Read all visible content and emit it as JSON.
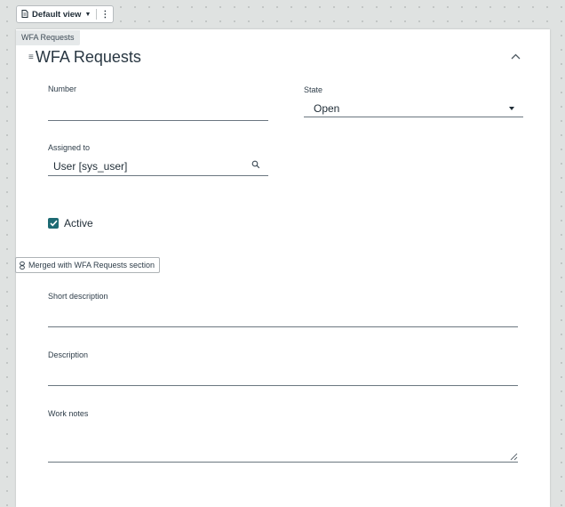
{
  "toolbar": {
    "view_label": "Default view",
    "more_label": "⋮"
  },
  "section": {
    "tag": "WFA Requests",
    "title": "WFA Requests",
    "drag_handle": "≡",
    "collapse": "^"
  },
  "fields": {
    "number": {
      "label": "Number",
      "value": ""
    },
    "state": {
      "label": "State",
      "value": "Open"
    },
    "assigned_to": {
      "label": "Assigned to",
      "value": "User [sys_user]"
    },
    "active": {
      "label": "Active",
      "checked": true
    },
    "short_description": {
      "label": "Short description",
      "value": ""
    },
    "description": {
      "label": "Description",
      "value": ""
    },
    "work_notes": {
      "label": "Work notes",
      "value": ""
    }
  },
  "merged_badge": {
    "label": "Merged with WFA Requests section"
  },
  "icons": {
    "view": "document-icon",
    "dropdown": "caret-down-icon",
    "more": "kebab-icon",
    "search": "search-icon",
    "check": "check-icon",
    "link": "link-icon",
    "resize": "resize-handle-icon"
  },
  "colors": {
    "checkbox": "#1d6a73",
    "panel": "#ffffff",
    "canvas": "#dfe2e1"
  }
}
